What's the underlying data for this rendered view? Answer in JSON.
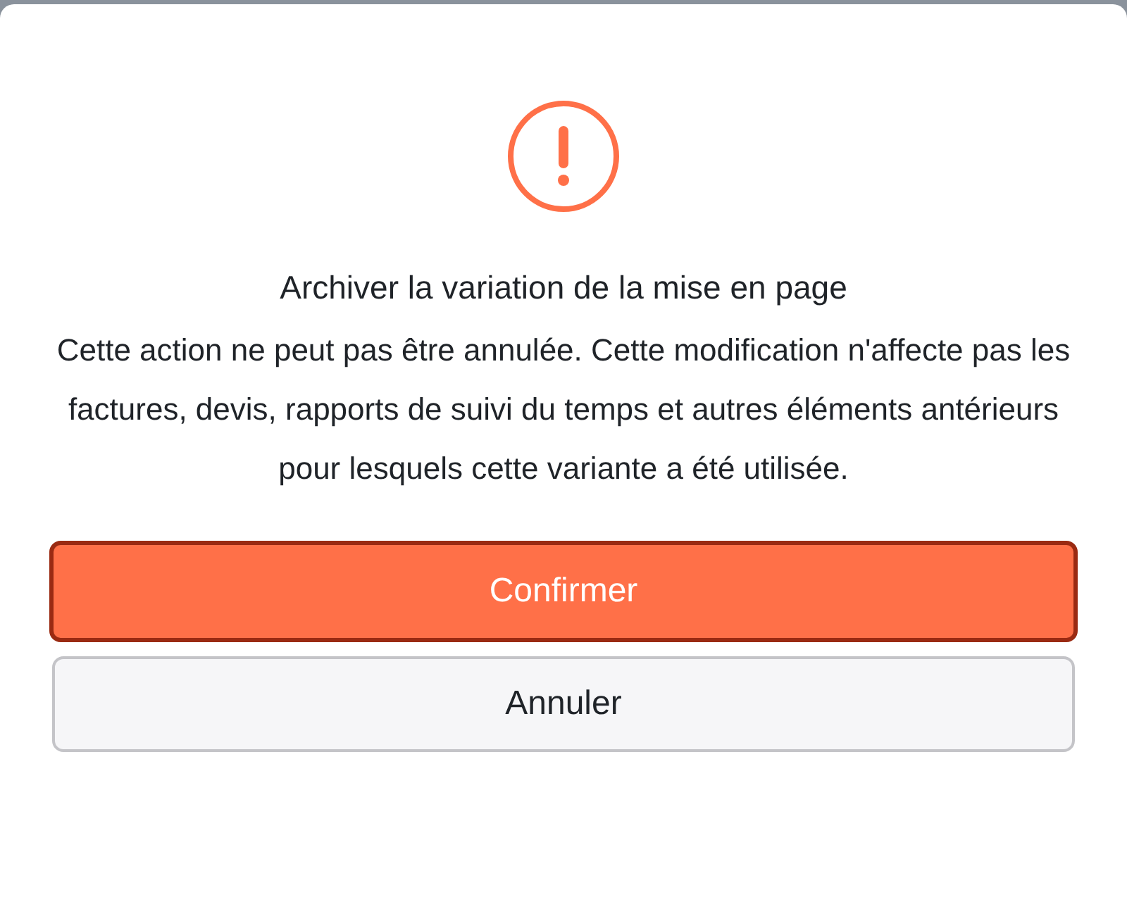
{
  "dialog": {
    "title": "Archiver la variation de la mise en page",
    "message": "Cette action ne peut pas être annulée. Cette modification n'affecte pas les factures, devis, rapports de suivi du temps et autres éléments antérieurs pour lesquels cette variante a été utilisée.",
    "buttons": [
      {
        "label": "Confirmer",
        "kind": "primary",
        "focused": true
      },
      {
        "label": "Annuler",
        "kind": "secondary",
        "focused": false
      }
    ]
  }
}
